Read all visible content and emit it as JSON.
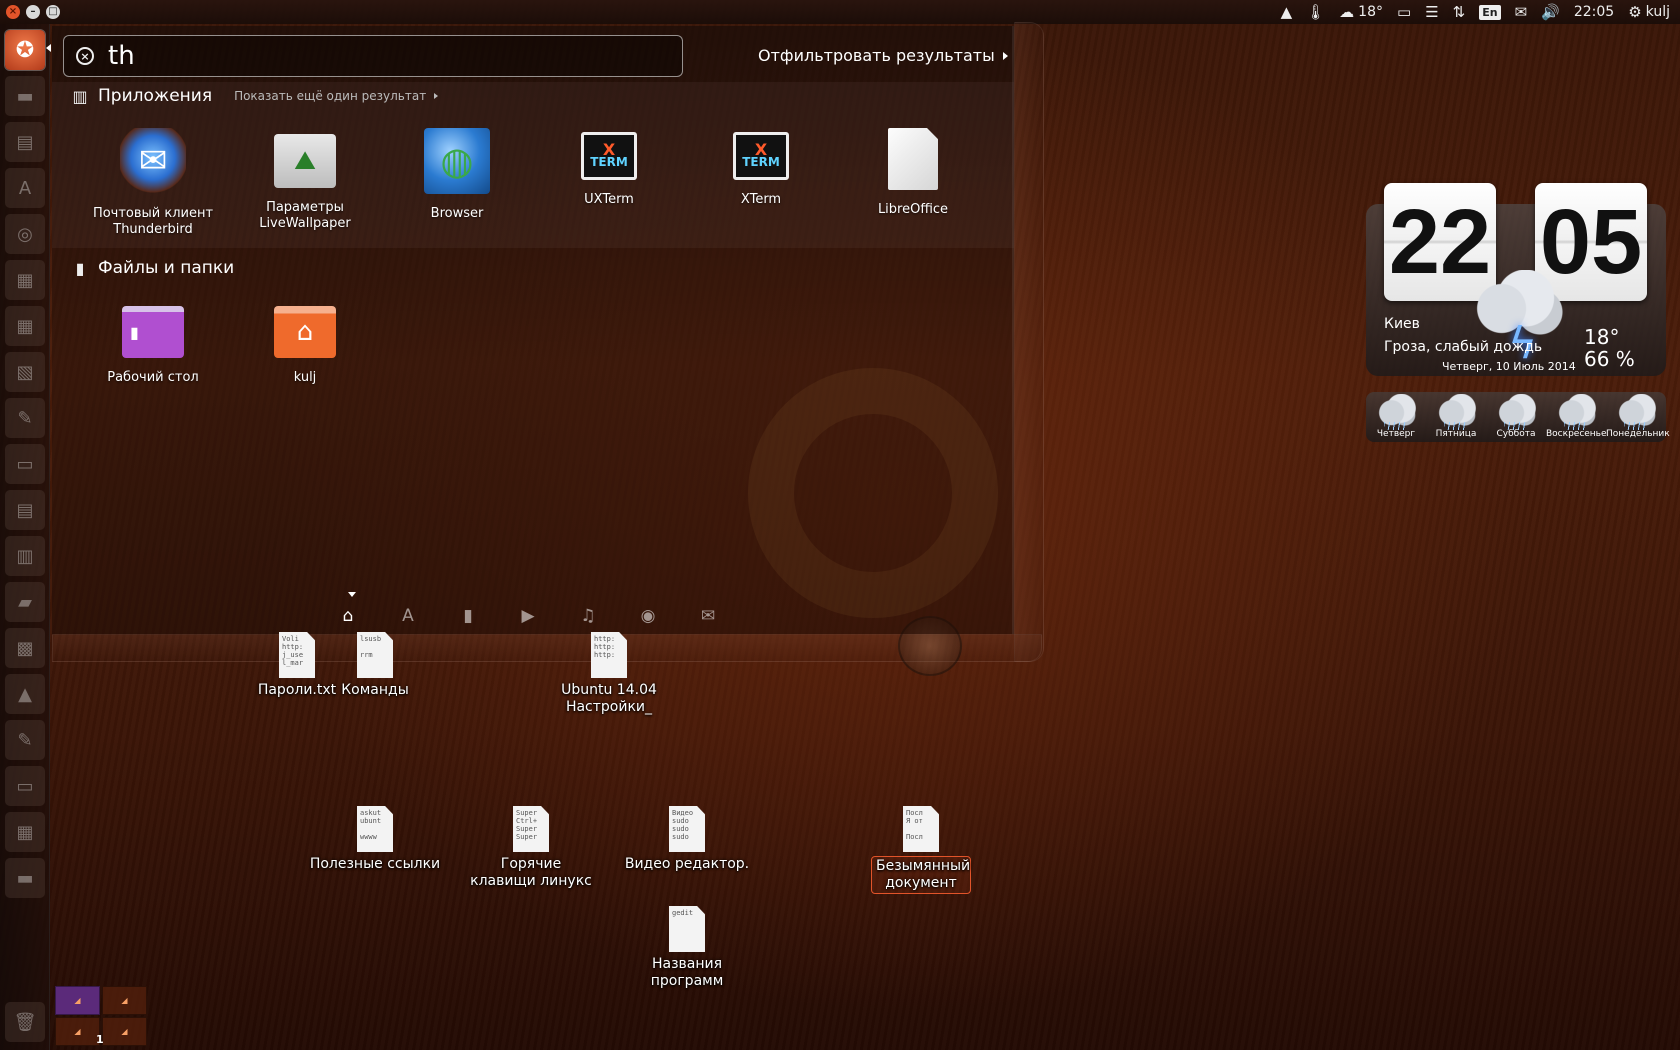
{
  "top_panel": {
    "temperature": "18°",
    "lang": "En",
    "time": "22:05",
    "user": "kulj"
  },
  "dash": {
    "search_value": "th",
    "filter_label": "Отфильтровать результаты",
    "apps_category": {
      "title": "Приложения",
      "more": "Показать ещё один результат",
      "items": [
        {
          "label": "Почтовый клиент Thunderbird",
          "icon": "thunderbird-icon"
        },
        {
          "label": "Параметры LiveWallpaper",
          "icon": "livewallpaper-icon"
        },
        {
          "label": "Browser",
          "icon": "browser-icon"
        },
        {
          "label": "UXTerm",
          "icon": "uxterm-icon"
        },
        {
          "label": "XTerm",
          "icon": "xterm-icon"
        },
        {
          "label": "LibreOffice",
          "icon": "libreoffice-icon"
        }
      ]
    },
    "files_category": {
      "title": "Файлы и папки",
      "items": [
        {
          "label": "Рабочий стол",
          "icon": "desktop-folder-icon"
        },
        {
          "label": "kulj",
          "icon": "home-folder-icon"
        }
      ]
    },
    "lenses": [
      "home-lens-icon",
      "applications-lens-icon",
      "files-lens-icon",
      "video-lens-icon",
      "music-lens-icon",
      "photos-lens-icon",
      "social-lens-icon"
    ]
  },
  "desktop_icons": [
    {
      "label": "Пароли.txt",
      "preview": "Voli\nhttp:\nj_use\nl_mar"
    },
    {
      "label": "Команды",
      "preview": "lsusb\n\nrrm"
    },
    {
      "label": "Ubuntu 14.04 Настройки_",
      "preview": "http:\nhttp:\nhttp:"
    },
    {
      "label": "Полезные ссылки",
      "preview": "askut\nubunt\n\nwwww"
    },
    {
      "label": "Горячие клавищи линукс",
      "preview": "Super\nCtrl+\nSuper\nSuper"
    },
    {
      "label": "Видео редактор.",
      "preview": "Видео\nsudo\nsudo\nsudo"
    },
    {
      "label": "Безымянный документ",
      "preview": "Посл\nЯ от\n\nПосл"
    },
    {
      "label": "Названия программ",
      "preview": "gedit"
    }
  ],
  "clock": {
    "hours": "22",
    "minutes": "05",
    "city": "Киев",
    "condition": "Гроза, слабый дождь",
    "temp": "18°",
    "humidity": "66 %",
    "date": "Четверг, 10 Июль 2014",
    "forecast": [
      "Четверг",
      "Пятница",
      "Суббота",
      "Воскресенье",
      "Понедельник"
    ]
  },
  "workspace": {
    "number": "1"
  }
}
